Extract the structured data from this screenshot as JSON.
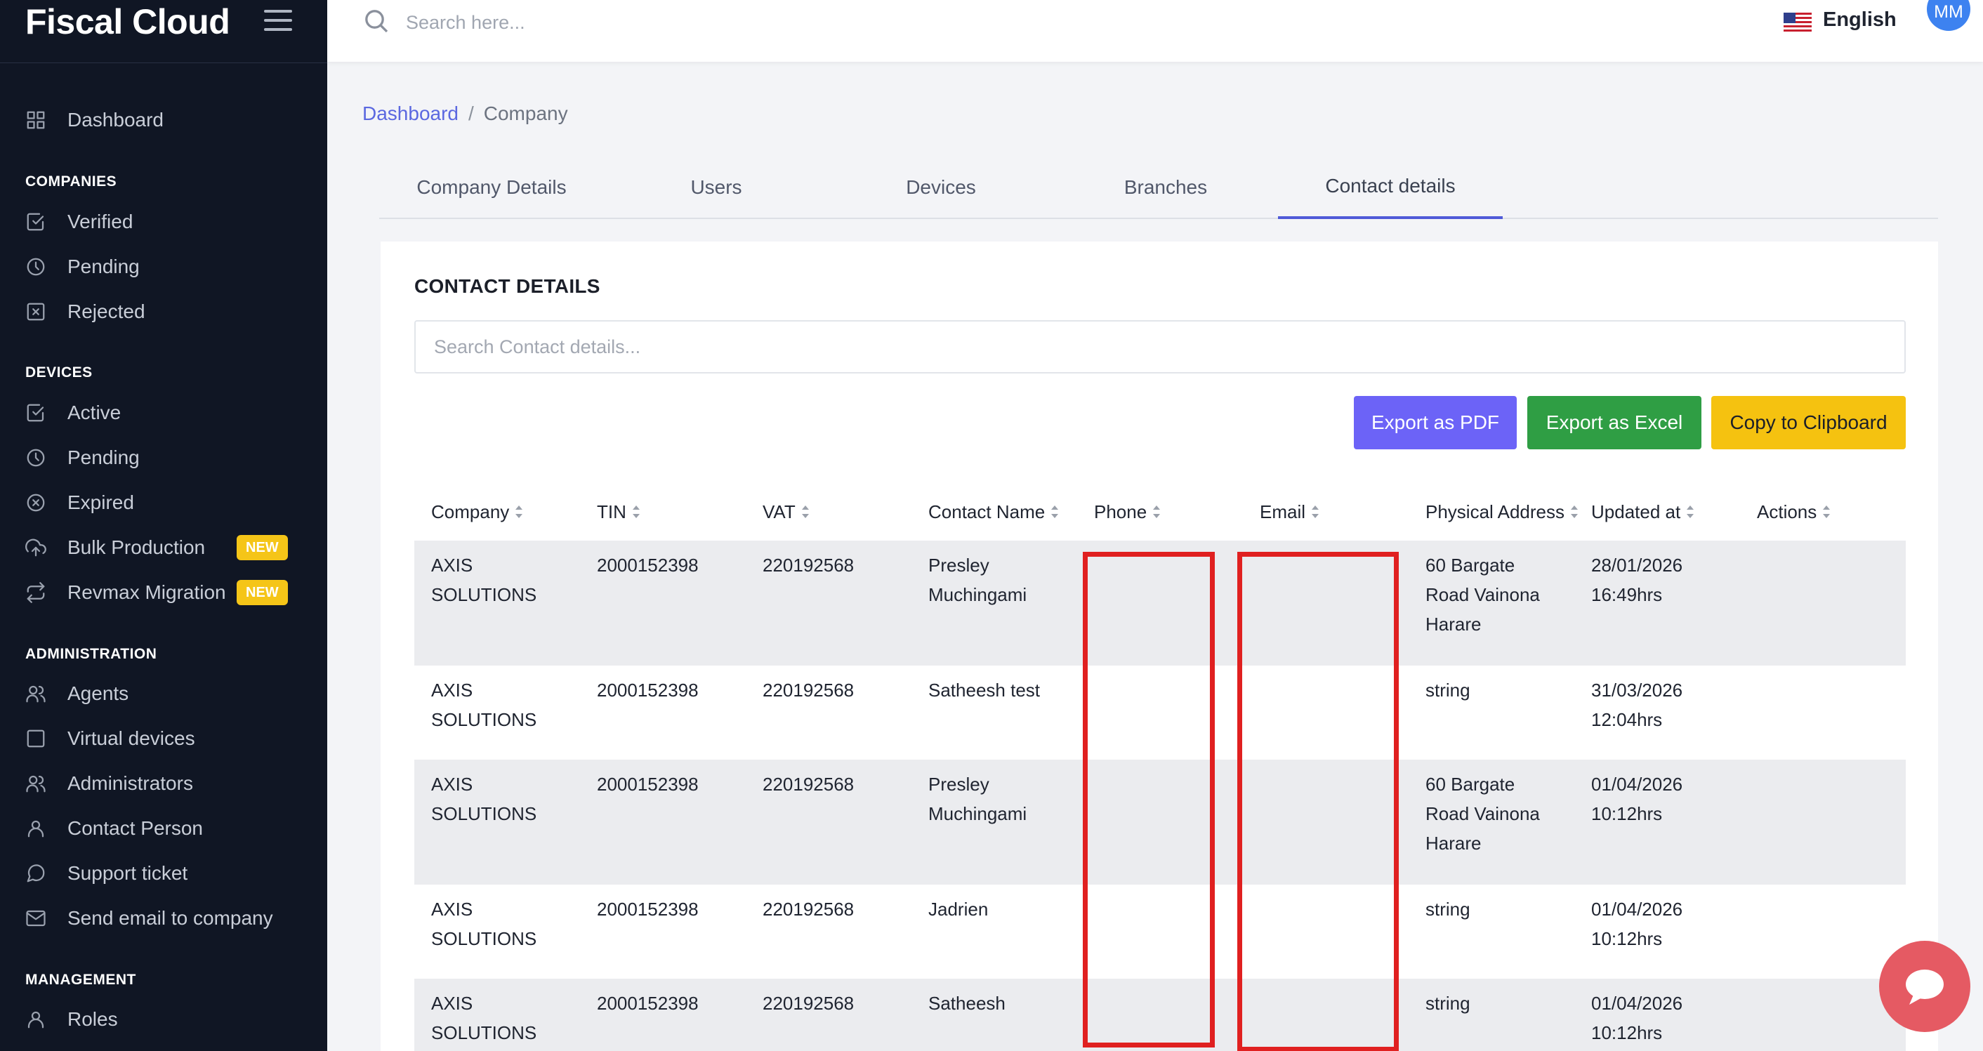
{
  "app": {
    "brand": "Fiscal Cloud"
  },
  "sidebar": {
    "dashboard": "Dashboard",
    "sections": {
      "companies": "COMPANIES",
      "devices": "DEVICES",
      "administration": "ADMINISTRATION",
      "management": "MANAGEMENT"
    },
    "companies": [
      {
        "label": "Verified",
        "icon": "check-square-icon"
      },
      {
        "label": "Pending",
        "icon": "clock-icon"
      },
      {
        "label": "Rejected",
        "icon": "x-square-icon"
      }
    ],
    "devices": [
      {
        "label": "Active",
        "icon": "check-square-icon"
      },
      {
        "label": "Pending",
        "icon": "clock-icon"
      },
      {
        "label": "Expired",
        "icon": "x-circle-icon"
      },
      {
        "label": "Bulk Production",
        "icon": "upload-cloud-icon",
        "badge": "NEW"
      },
      {
        "label": "Revmax Migration",
        "icon": "repeat-icon",
        "badge": "NEW"
      }
    ],
    "administration": [
      {
        "label": "Agents",
        "icon": "users-icon"
      },
      {
        "label": "Virtual devices",
        "icon": "square-icon"
      },
      {
        "label": "Administrators",
        "icon": "users-icon"
      },
      {
        "label": "Contact Person",
        "icon": "user-icon"
      },
      {
        "label": "Support ticket",
        "icon": "message-circle-icon"
      },
      {
        "label": "Send email to company",
        "icon": "mail-icon"
      }
    ],
    "management": [
      {
        "label": "Roles",
        "icon": "user-icon"
      }
    ]
  },
  "topbar": {
    "search_placeholder": "Search here...",
    "language": "English",
    "avatar_initials": "MM"
  },
  "breadcrumb": {
    "root": "Dashboard",
    "separator": "/",
    "current": "Company"
  },
  "tabs": [
    {
      "label": "Company Details",
      "active": false
    },
    {
      "label": "Users",
      "active": false
    },
    {
      "label": "Devices",
      "active": false
    },
    {
      "label": "Branches",
      "active": false
    },
    {
      "label": "Contact details",
      "active": true
    }
  ],
  "card": {
    "title": "CONTACT DETAILS",
    "search_placeholder": "Search Contact details...",
    "buttons": {
      "pdf": "Export as PDF",
      "excel": "Export as Excel",
      "clipboard": "Copy to Clipboard"
    }
  },
  "table": {
    "columns": [
      "Company",
      "TIN",
      "VAT",
      "Contact Name",
      "Phone",
      "Email",
      "Physical Address",
      "Updated at",
      "Actions"
    ],
    "rows": [
      {
        "company": [
          "AXIS",
          "SOLUTIONS"
        ],
        "tin": "2000152398",
        "vat": "220192568",
        "contact": [
          "Presley",
          "Muchingami"
        ],
        "address": [
          "60 Bargate",
          "Road Vainona",
          "Harare"
        ],
        "updated": [
          "28/01/2026",
          "16:49hrs"
        ]
      },
      {
        "company": [
          "AXIS",
          "SOLUTIONS"
        ],
        "tin": "2000152398",
        "vat": "220192568",
        "contact": [
          "Satheesh test"
        ],
        "address": [
          "string"
        ],
        "updated": [
          "31/03/2026",
          "12:04hrs"
        ]
      },
      {
        "company": [
          "AXIS",
          "SOLUTIONS"
        ],
        "tin": "2000152398",
        "vat": "220192568",
        "contact": [
          "Presley",
          "Muchingami"
        ],
        "address": [
          "60 Bargate",
          "Road Vainona",
          "Harare"
        ],
        "updated": [
          "01/04/2026",
          "10:12hrs"
        ]
      },
      {
        "company": [
          "AXIS",
          "SOLUTIONS"
        ],
        "tin": "2000152398",
        "vat": "220192568",
        "contact": [
          "Jadrien"
        ],
        "address": [
          "string"
        ],
        "updated": [
          "01/04/2026",
          "10:12hrs"
        ]
      },
      {
        "company": [
          "AXIS",
          "SOLUTIONS"
        ],
        "tin": "2000152398",
        "vat": "220192568",
        "contact": [
          "Satheesh"
        ],
        "address": [
          "string"
        ],
        "updated": [
          "01/04/2026",
          "10:12hrs"
        ]
      }
    ]
  },
  "colors": {
    "sidebar_bg": "#101624",
    "accent": "#5b68e0",
    "pdf_button": "#6c63f7",
    "excel_button": "#2f9e44",
    "clipboard_button": "#f5c210",
    "badge": "#f5c518",
    "redaction": "#e02020",
    "chat_button": "#e55a63"
  }
}
